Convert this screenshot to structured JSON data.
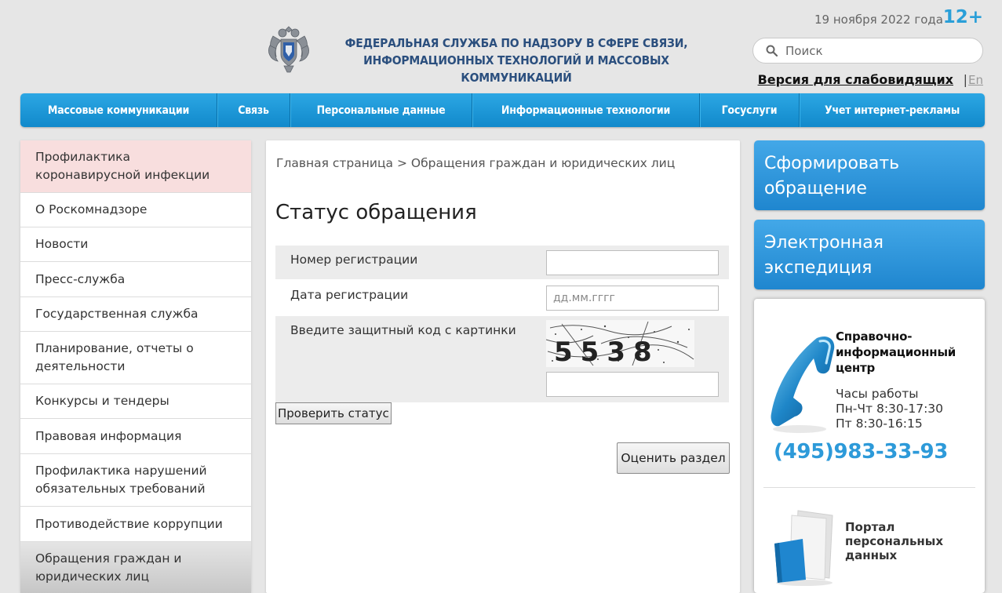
{
  "header": {
    "date": "19 ноября 2022 года",
    "age_rating": "12+",
    "org_line1": "ФЕДЕРАЛЬНАЯ СЛУЖБА ПО НАДЗОРУ В СФЕРЕ СВЯЗИ,",
    "org_line2": "ИНФОРМАЦИОННЫХ ТЕХНОЛОГИЙ И МАССОВЫХ КОММУНИКАЦИЙ",
    "search_placeholder": "Поиск",
    "a11y_link": "Версия для слабовидящих",
    "separator": "|",
    "lang_link": "En"
  },
  "nav": {
    "items": [
      {
        "label": "Массовые коммуникации"
      },
      {
        "label": "Связь"
      },
      {
        "label": "Персональные данные"
      },
      {
        "label": "Информационные технологии"
      },
      {
        "label": "Госуслуги"
      },
      {
        "label": "Учет интернет-рекламы"
      }
    ]
  },
  "sidebar": {
    "items": [
      {
        "label": "Профилактика коронавирусной инфекции"
      },
      {
        "label": "О Роскомнадзоре"
      },
      {
        "label": "Новости"
      },
      {
        "label": "Пресс-служба"
      },
      {
        "label": "Государственная служба"
      },
      {
        "label": "Планирование, отчеты о деятельности"
      },
      {
        "label": "Конкурсы и тендеры"
      },
      {
        "label": "Правовая информация"
      },
      {
        "label": "Профилактика нарушений обязательных требований"
      },
      {
        "label": "Противодействие коррупции"
      },
      {
        "label": "Обращения граждан и юридических лиц"
      }
    ]
  },
  "main": {
    "breadcrumb": "Главная страница > Обращения граждан и юридических лиц",
    "title": "Статус обращения",
    "reg_number_label": "Номер регистрации",
    "reg_number_value": "",
    "reg_date_label": "Дата регистрации",
    "reg_date_placeholder": "дд.мм.гггг",
    "captcha_label": "Введите защитный код с картинки",
    "captcha_code": "5538",
    "captcha_value": "",
    "check_button": "Проверить статус",
    "rate_button": "Оценить раздел"
  },
  "right": {
    "form_button": "Сформировать обращение",
    "expedition_button": "Электронная экспедиция",
    "help_title": "Справочно-информационный центр",
    "hours_title": "Часы работы",
    "hours_weekdays": "Пн-Чт 8:30-17:30",
    "hours_friday": "Пт 8:30-16:15",
    "phone": "(495)983-33-93",
    "portal_title_line1": "Портал",
    "portal_title_line2": "персональных",
    "portal_title_line3": "данных"
  },
  "colors": {
    "accent": "#2a9fd8",
    "nav_blue": "#1a95d6",
    "highlight_pink": "#f8dede",
    "org_text": "#2b4f7e"
  },
  "icons": [
    "emblem-icon",
    "search-icon",
    "phone-handset-icon",
    "documents-icon"
  ]
}
